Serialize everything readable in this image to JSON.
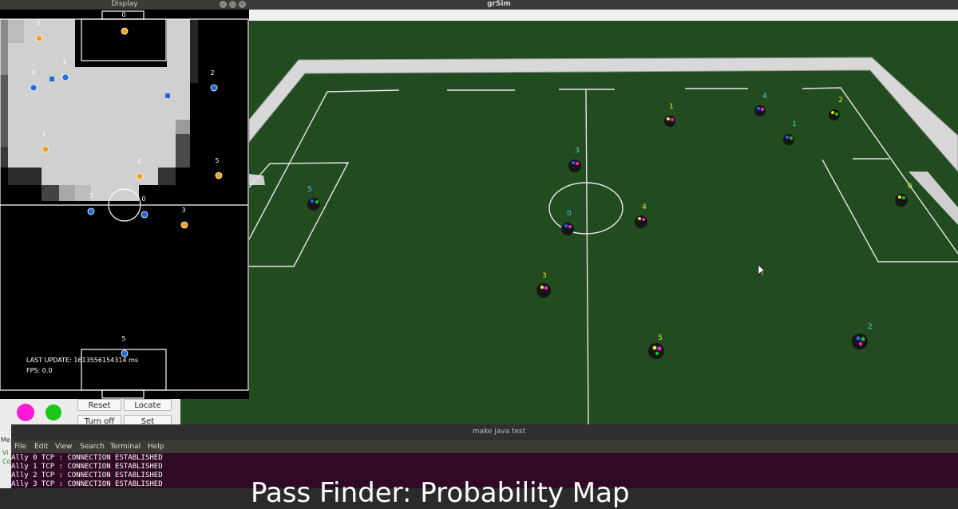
{
  "grsim": {
    "title": "grSim",
    "robots": [
      {
        "id": "1",
        "team": "yellow"
      },
      {
        "id": "4",
        "team": "blue"
      },
      {
        "id": "2",
        "team": "yellow"
      },
      {
        "id": "1",
        "team": "blue"
      },
      {
        "id": "3",
        "team": "blue"
      },
      {
        "id": "5",
        "team": "blue"
      },
      {
        "id": "0",
        "team": "blue"
      },
      {
        "id": "4",
        "team": "yellow"
      },
      {
        "id": "0",
        "team": "yellow"
      },
      {
        "id": "3",
        "team": "yellow"
      },
      {
        "id": "5",
        "team": "yellow"
      },
      {
        "id": "2",
        "team": "blue"
      }
    ]
  },
  "display": {
    "title": "Display",
    "last_update": "LAST UPDATE: 1613556154314 ms",
    "fps": "FPS: 0.0",
    "labels": [
      "0",
      "2",
      "1",
      "4",
      "2",
      "1",
      "5",
      "4",
      "3",
      "0",
      "3",
      "5"
    ]
  },
  "control": {
    "reset": "Reset",
    "locate": "Locate",
    "turn_off": "Turn off",
    "set_position": "Set Position",
    "color_a": "#ff18d6",
    "color_b": "#19c819",
    "side_label_1": "Me",
    "side_label_2": "Vi",
    "side_label_3": "Co"
  },
  "terminal": {
    "title": "make java test",
    "menu": [
      "File",
      "Edit",
      "View",
      "Search",
      "Terminal",
      "Help"
    ],
    "lines": [
      "Ally 0 TCP : CONNECTION ESTABLISHED",
      "Ally 1 TCP : CONNECTION ESTABLISHED",
      "Ally 2 TCP : CONNECTION ESTABLISHED",
      "Ally 3 TCP : CONNECTION ESTABLISHED"
    ],
    "overlay": "Pass Finder: Probability Map"
  },
  "colors": {
    "field": "#204a1e",
    "yellow_label": "#e8e832",
    "blue_label": "#3ad6d6"
  }
}
